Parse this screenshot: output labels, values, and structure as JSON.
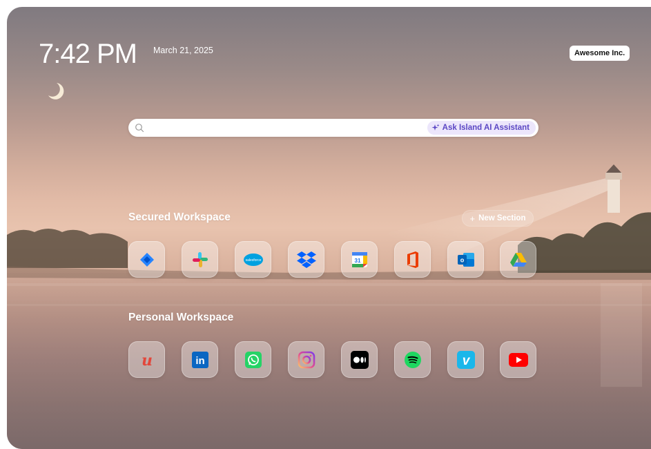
{
  "clock": {
    "time": "7:42 PM",
    "date": "March 21, 2025"
  },
  "org_badge": "Awesome Inc.",
  "search": {
    "placeholder": "",
    "ai_button_label": "Ask Island AI Assistant"
  },
  "sections": [
    {
      "title": "Secured Workspace",
      "apps": [
        "jira-icon",
        "slack-icon",
        "salesforce-icon",
        "dropbox-icon",
        "google-calendar-icon",
        "office-icon",
        "outlook-icon",
        "google-drive-icon"
      ]
    },
    {
      "title": "Personal Workspace",
      "apps": [
        "udemy-icon",
        "linkedin-icon",
        "whatsapp-icon",
        "instagram-icon",
        "medium-icon",
        "spotify-icon",
        "vimeo-icon",
        "youtube-icon"
      ]
    }
  ],
  "new_section_label": "New Section",
  "icon_text": {
    "salesforce": "salesforce",
    "calendar_day": "31",
    "udemy": "u",
    "linkedin": "in",
    "vimeo": "v",
    "outlook": "o"
  },
  "colors": {
    "ai_accent": "#5b47c4",
    "jira": "#2684ff",
    "dropbox": "#0061ff",
    "salesforce": "#00a1e0",
    "office": "#eb3c00",
    "outlook": "#0078d4",
    "linkedin": "#0a66c2",
    "whatsapp": "#25d366",
    "spotify": "#1ed760",
    "vimeo": "#1ab7ea",
    "youtube": "#ff0000",
    "udemy": "#e2473b"
  }
}
